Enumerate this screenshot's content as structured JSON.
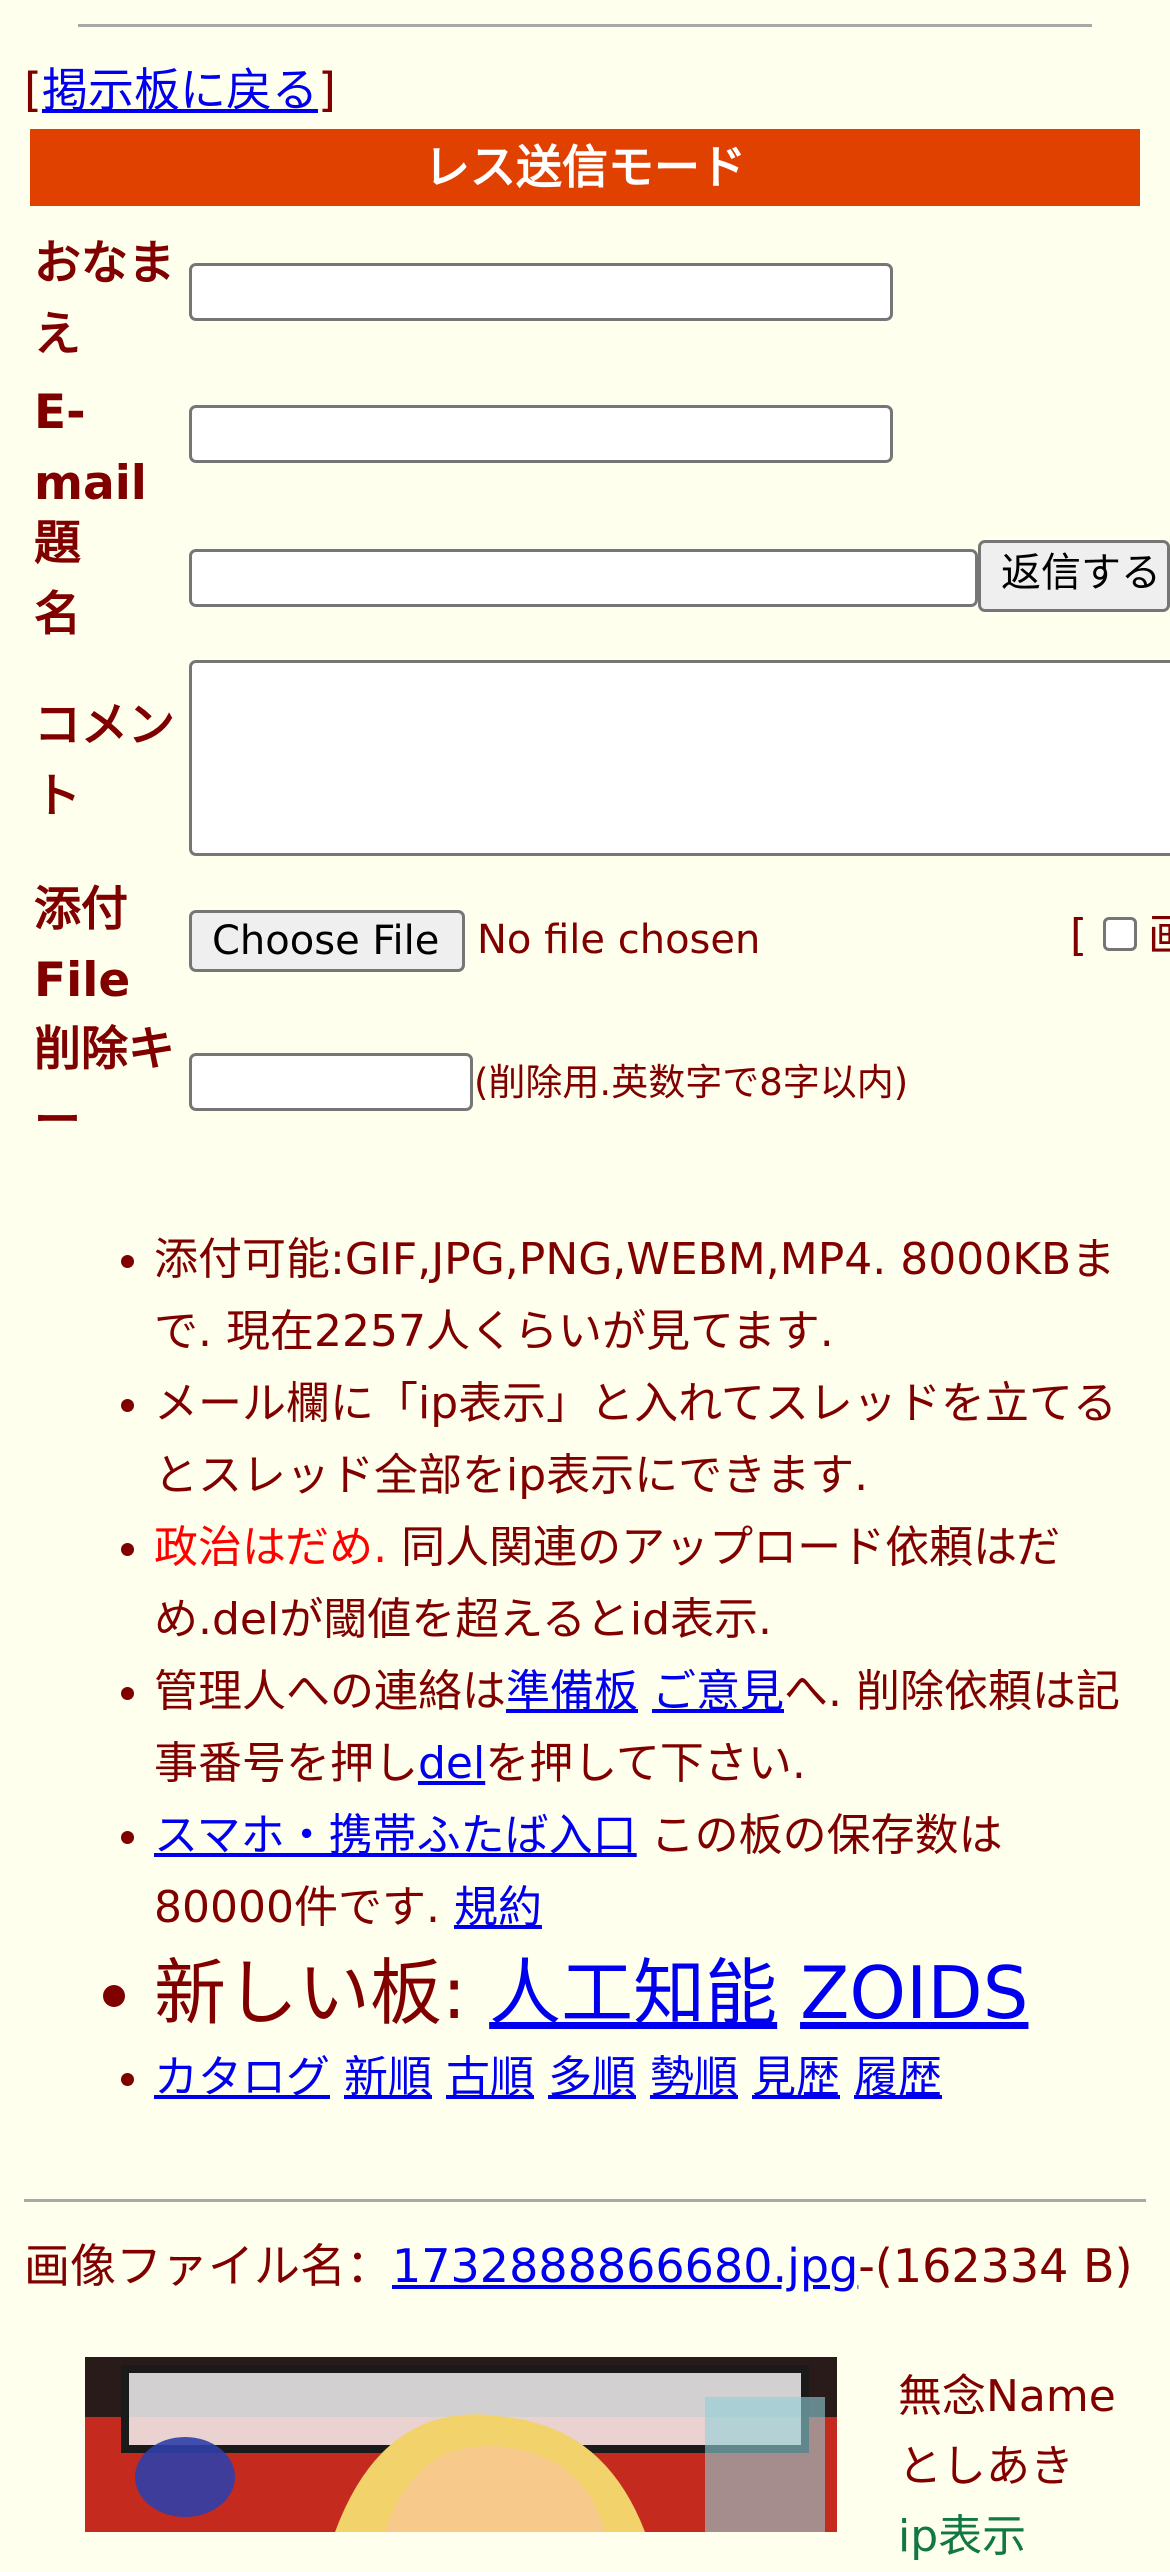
{
  "nav": {
    "bracket_open": "[",
    "back_link": "掲示板に戻る",
    "bracket_close": "]"
  },
  "mode_bar": {
    "title": "レス送信モード"
  },
  "form": {
    "name_label": "おなまえ",
    "email_label": "E-mail",
    "subject_label": "題名",
    "submit_label": "返信する",
    "comment_label": "コメント",
    "file_label": "添付File",
    "choose_file_label": "Choose File",
    "no_file_text": "No file chosen",
    "image_option_bracket": "[",
    "image_option_char": "画",
    "delete_key_label": "削除キー",
    "delete_key_hint": "(削除用.英数字で8字以内)"
  },
  "notes": {
    "n1": "添付可能:GIF,JPG,PNG,WEBM,MP4. 8000KBまで. 現在2257人くらいが見てます.",
    "n2": "メール欄に「ip表示」と入れてスレッドを立てるとスレッド全部をip表示にできます.",
    "n3_red": "政治はだめ.",
    "n3_rest": " 同人関連のアップロード依頼はだめ.delが閾値を超えるとid表示.",
    "n4_pre": "管理人への連絡は",
    "n4_link1": "準備板",
    "n4_sp": " ",
    "n4_link2": "ご意見",
    "n4_mid": "へ. 削除依頼は記事番号を押し",
    "n4_link3": "del",
    "n4_post": "を押して下さい.",
    "n5_link": "スマホ・携帯ふたば入口",
    "n5_mid": " この板の保存数は80000件です. ",
    "n5_link2": "規約",
    "n6_label": "新しい板: ",
    "n6_link1": "人工知能",
    "n6_link2": "ZOIDS",
    "n7_links": [
      "カタログ",
      "新順",
      "古順",
      "多順",
      "勢順",
      "見歴",
      "履歴"
    ]
  },
  "post": {
    "file_label": "画像ファイル名：",
    "file_link": "1732888866680.jpg",
    "file_size": "-(162334 B)",
    "name_line1": "無念Name",
    "name_line2": "としあき",
    "id_partial": "ip表示"
  },
  "colors": {
    "background": "#ffffee",
    "text": "#800000",
    "mode_bar": "#e04000",
    "link": "#0000ee",
    "warning": "#ff0000"
  }
}
